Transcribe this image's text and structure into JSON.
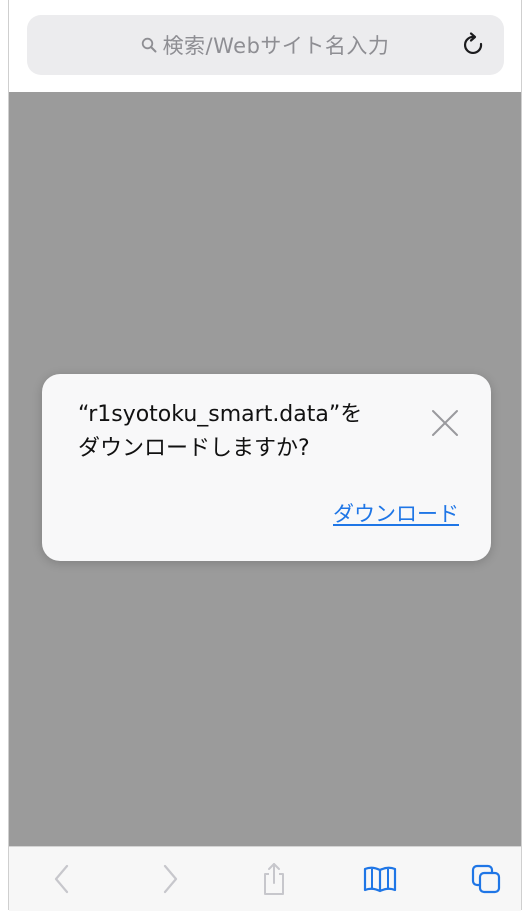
{
  "browser": {
    "search_placeholder": "検索/Webサイト名入力"
  },
  "dialog": {
    "message_line1": "“r1syotoku_smart.data”を",
    "message_line2": "ダウンロードしますか?",
    "download_label": "ダウンロード"
  },
  "toolbar": {
    "back_enabled": false,
    "forward_enabled": false,
    "share_enabled": false
  },
  "colors": {
    "accent": "#1f76e6",
    "overlay": "#9b9b9b",
    "disabled_icon": "#c7c7cc"
  }
}
